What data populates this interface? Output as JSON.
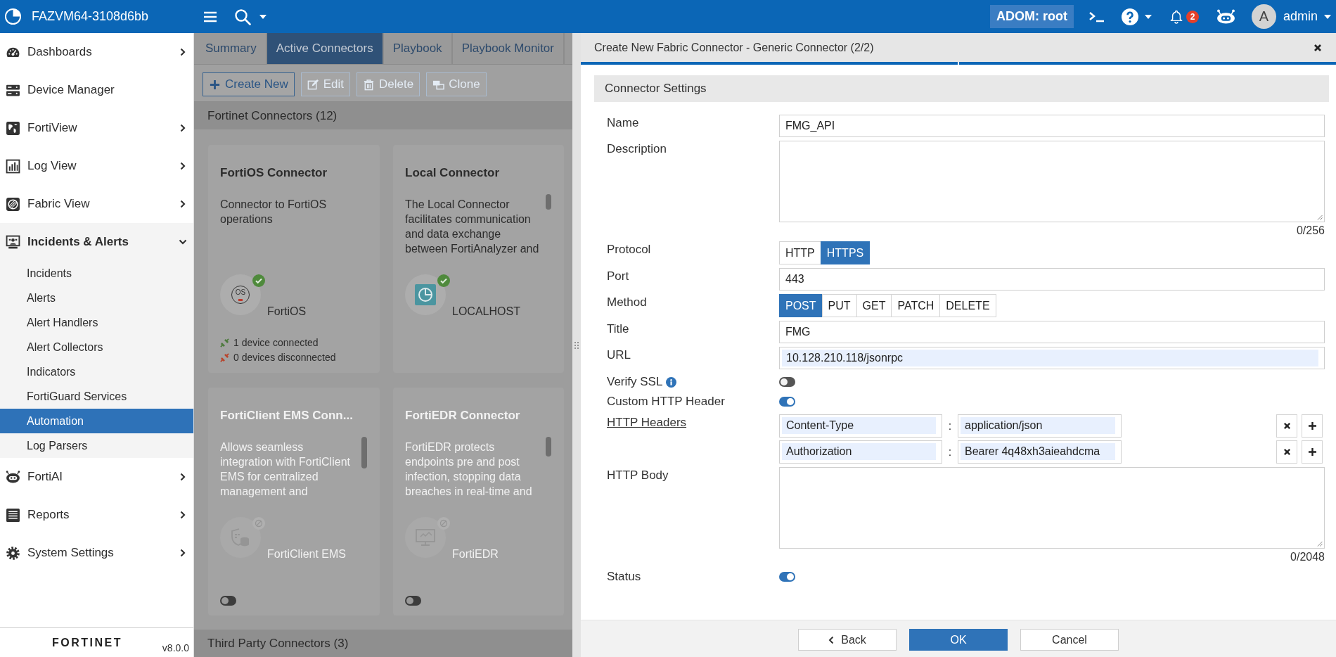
{
  "top_bar": {
    "title": "FAZVM64-3108d6bb",
    "adom": "ADOM: root",
    "notifications": "2",
    "avatar_letter": "A",
    "user": "admin"
  },
  "sidebar": {
    "items": [
      {
        "label": "Dashboards",
        "submenu": true,
        "expanded": false,
        "selected": false
      },
      {
        "label": "Device Manager",
        "submenu": false,
        "expanded": false,
        "selected": false
      },
      {
        "label": "FortiView",
        "submenu": true,
        "expanded": false,
        "selected": false
      },
      {
        "label": "Log View",
        "submenu": true,
        "expanded": false,
        "selected": false
      },
      {
        "label": "Fabric View",
        "submenu": true,
        "expanded": false,
        "selected": false
      },
      {
        "label": "Incidents & Alerts",
        "submenu": true,
        "expanded": true,
        "selected": false,
        "children": [
          {
            "label": "Incidents",
            "selected": false
          },
          {
            "label": "Alerts",
            "selected": false
          },
          {
            "label": "Alert Handlers",
            "selected": false
          },
          {
            "label": "Alert Collectors",
            "selected": false
          },
          {
            "label": "Indicators",
            "selected": false
          },
          {
            "label": "FortiGuard Services",
            "selected": false
          },
          {
            "label": "Automation",
            "selected": true
          },
          {
            "label": "Log Parsers",
            "selected": false
          }
        ]
      },
      {
        "label": "FortiAI",
        "submenu": true,
        "expanded": false,
        "selected": false
      },
      {
        "label": "Reports",
        "submenu": true,
        "expanded": false,
        "selected": false
      },
      {
        "label": "System Settings",
        "submenu": true,
        "expanded": false,
        "selected": false
      }
    ],
    "logo": "FORTINET",
    "version": "v8.0.0"
  },
  "tabs": [
    {
      "label": "Summary",
      "selected": false
    },
    {
      "label": "Active Connectors",
      "selected": true
    },
    {
      "label": "Playbook",
      "selected": false
    },
    {
      "label": "Playbook Monitor",
      "selected": false
    }
  ],
  "toolbar": [
    {
      "label": "Create New",
      "disabled": false
    },
    {
      "label": "Edit",
      "disabled": true
    },
    {
      "label": "Delete",
      "disabled": true
    },
    {
      "label": "Clone",
      "disabled": true
    }
  ],
  "connector_sections": [
    {
      "title": "Fortinet Connectors (12)",
      "cards": [
        {
          "title": "FortiOS Connector",
          "description_lines": [
            "Connector to FortiOS",
            "operations"
          ],
          "active": true,
          "icon_text": "OS",
          "device_label": "FortiOS",
          "stats": [
            {
              "kind": "connected",
              "text": "1 device connected"
            },
            {
              "kind": "disconnected",
              "text": "0 devices disconnected"
            }
          ]
        },
        {
          "title": "Local Connector",
          "description_lines": [
            "The Local Connector",
            "facilitates communication",
            "and data exchange",
            "between FortiAnalyzer and"
          ],
          "active": true,
          "device_label": "LOCALHOST",
          "scrollable": true
        },
        {
          "title": "FortiClient EMS Conn...",
          "description_lines": [
            "Allows seamless",
            "integration with FortiClient",
            "EMS for centralized",
            "management and"
          ],
          "active": false,
          "device_label": "FortiClient EMS",
          "scrollable": true,
          "toggle_on": false
        },
        {
          "title": "FortiEDR Connector",
          "description_lines": [
            "FortiEDR protects",
            "endpoints pre and post",
            "infection, stopping data",
            "breaches in real-time and"
          ],
          "active": false,
          "device_label": "FortiEDR",
          "scrollable": true,
          "toggle_on": false
        }
      ]
    },
    {
      "title": "Third Party Connectors (3)"
    }
  ],
  "panel": {
    "title": "Create New Fabric Connector - Generic Connector (2/2)",
    "steps": [
      {
        "complete": true
      },
      {
        "complete": true
      }
    ],
    "section": "Connector Settings",
    "fields": [
      {
        "kind": "text",
        "label": "Name",
        "value": "FMG_API"
      },
      {
        "kind": "textarea",
        "label": "Description",
        "counter": "0/256"
      },
      {
        "kind": "segmented",
        "label": "Protocol",
        "options": [
          {
            "label": "HTTP",
            "selected": false
          },
          {
            "label": "HTTPS",
            "selected": true
          }
        ]
      },
      {
        "kind": "text",
        "label": "Port",
        "value": "443"
      },
      {
        "kind": "segmented",
        "label": "Method",
        "options": [
          {
            "label": "POST",
            "selected": true
          },
          {
            "label": "PUT",
            "selected": false
          },
          {
            "label": "GET",
            "selected": false
          },
          {
            "label": "PATCH",
            "selected": false
          },
          {
            "label": "DELETE",
            "selected": false
          }
        ]
      },
      {
        "kind": "text",
        "label": "Title",
        "value": "FMG"
      },
      {
        "kind": "text",
        "label": "URL",
        "value": "10.128.210.118/jsonrpc",
        "autofilled": true
      },
      {
        "kind": "toggle",
        "label": "Verify SSL",
        "info": true,
        "on": false
      },
      {
        "kind": "toggle",
        "label": "Custom HTTP Header",
        "on": true
      },
      {
        "kind": "headers",
        "label": "HTTP Headers",
        "rows": [
          {
            "key": "Content-Type",
            "separator": ":",
            "value": "application/json",
            "autofilled": true
          },
          {
            "key": "Authorization",
            "separator": ":",
            "value": "Bearer 4q48xh3aieahdcma",
            "autofilled": true
          }
        ]
      },
      {
        "kind": "textarea",
        "label": "HTTP Body",
        "counter": "0/2048"
      },
      {
        "kind": "toggle",
        "label": "Status",
        "on": true
      }
    ],
    "buttons": [
      {
        "label": "Back",
        "kind": "back"
      },
      {
        "label": "OK",
        "kind": "primary"
      },
      {
        "label": "Cancel",
        "kind": "default"
      }
    ]
  }
}
